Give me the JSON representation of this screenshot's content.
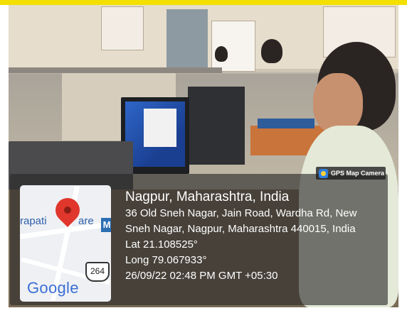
{
  "geo_tag": {
    "city_line": "Nagpur, Maharashtra, India",
    "address_line_1": "36 Old Sneh Nagar, Jain Road, Wardha Rd, New",
    "address_line_2": "Sneh Nagar, Nagpur, Maharashtra 440015, India",
    "latitude": "Lat 21.108525°",
    "longitude": "Long 79.067933°",
    "datetime": "26/09/22 02:48 PM GMT +05:30"
  },
  "app_badge": {
    "label": "GPS Map Camera",
    "icon": "gps-camera-icon"
  },
  "map": {
    "road_label": "rapati",
    "road_label_2": "are",
    "highway_shield": "264",
    "brand": "Google",
    "transit_badge": "M",
    "marker_icon": "map-pin-icon"
  },
  "colors": {
    "top_bar": "#f3e000",
    "overlay": "#282828",
    "pin": "#e0362b"
  }
}
